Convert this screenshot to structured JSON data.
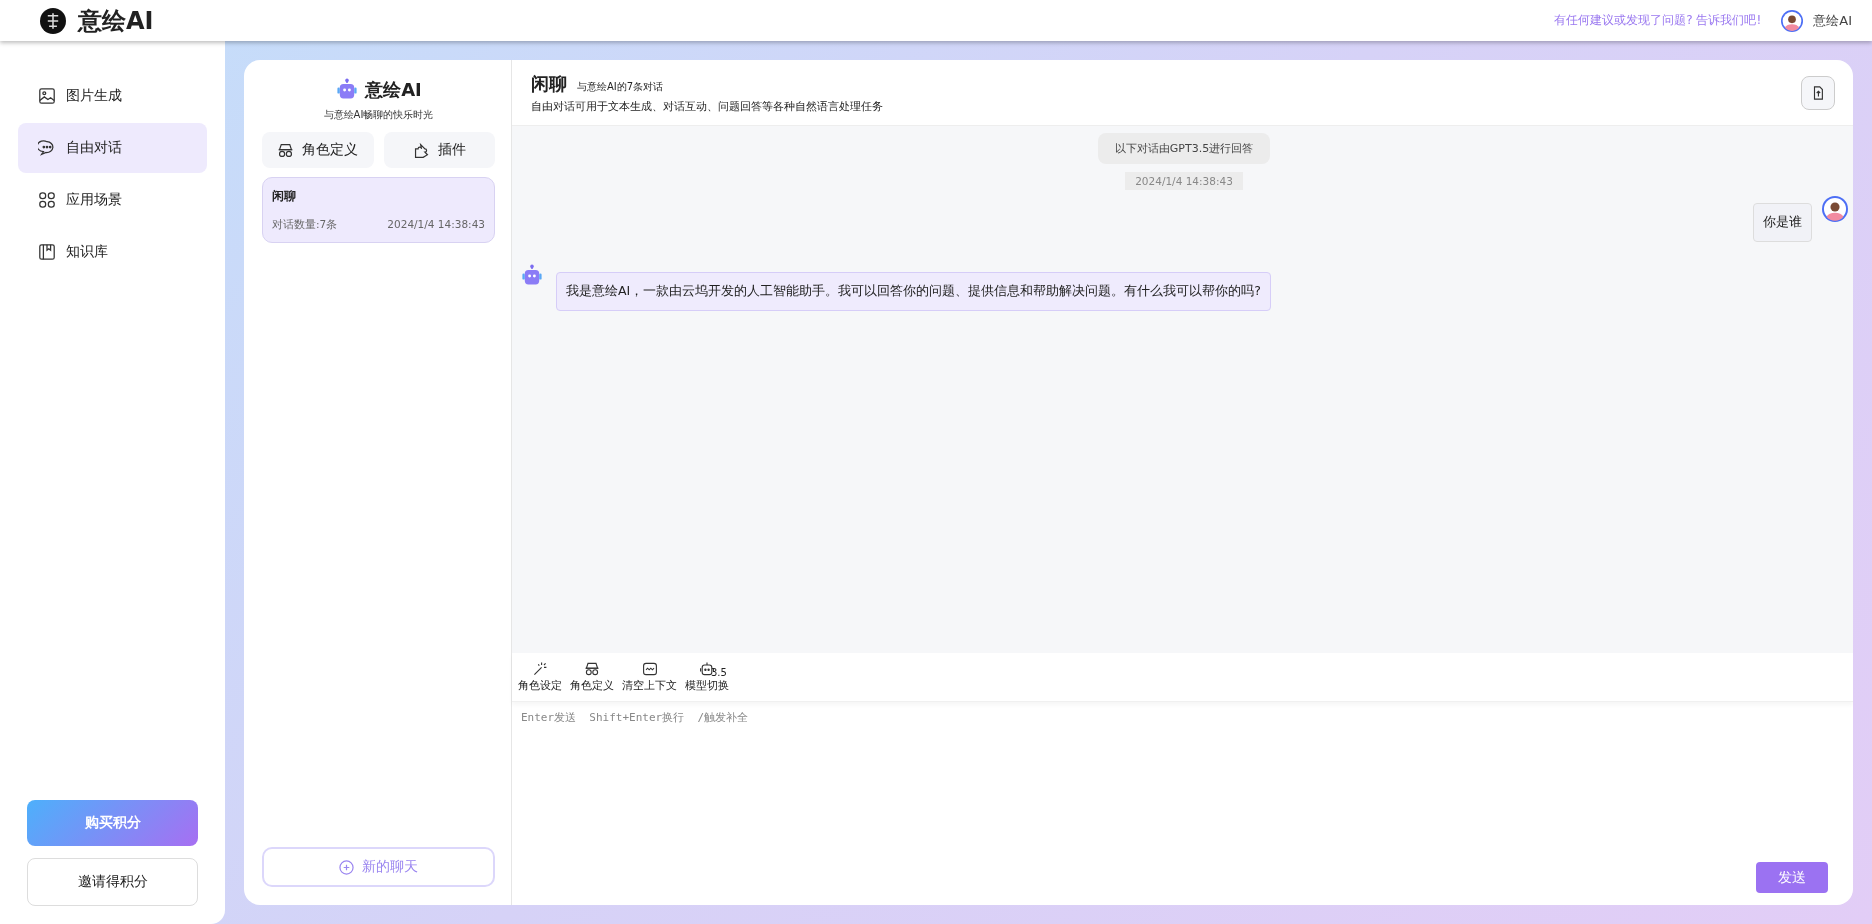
{
  "app": {
    "name": "意绘AI"
  },
  "header": {
    "feedback_link": "有任何建议或发现了问题? 告诉我们吧!",
    "user_name": "意绘AI"
  },
  "nav": [
    {
      "label": "图片生成",
      "kind": "image",
      "selected": false
    },
    {
      "label": "自由对话",
      "kind": "chat",
      "selected": true
    },
    {
      "label": "应用场景",
      "kind": "apps",
      "selected": false
    },
    {
      "label": "知识库",
      "kind": "book",
      "selected": false
    }
  ],
  "credits": {
    "buy": "购买积分",
    "invite": "邀请得积分"
  },
  "assistant": {
    "name": "意绘AI",
    "tagline": "与意绘AI畅聊的快乐时光",
    "buttons": [
      {
        "label": "角色定义",
        "kind": "mask"
      },
      {
        "label": "插件",
        "kind": "plugin"
      }
    ]
  },
  "sessions": [
    {
      "title": "闲聊",
      "count": "对话数量:7条",
      "time": "2024/1/4 14:38:43",
      "selected": true
    }
  ],
  "new_chat": "新的聊天",
  "chat": {
    "title": "闲聊",
    "subtitle": "与意绘AI的7条对话",
    "description": "自由对话可用于文本生成、对话互动、问题回答等各种自然语言处理任务",
    "notice": "以下对话由GPT3.5进行回答",
    "timestamp": "2024/1/4 14:38:43",
    "messages": [
      {
        "kind": "user",
        "text": "你是谁"
      },
      {
        "kind": "assistant",
        "text": "我是意绘AI，一款由云坞开发的人工智能助手。我可以回答你的问题、提供信息和帮助解决问题。有什么我可以帮你的吗?"
      }
    ]
  },
  "tools": [
    {
      "label": "角色设定",
      "kind": "wand"
    },
    {
      "label": "角色定义",
      "kind": "mask"
    },
    {
      "label": "清空上下文",
      "kind": "clear"
    },
    {
      "label": "模型切换",
      "kind": "robot",
      "badge": "3.5"
    }
  ],
  "input": {
    "placeholder": "Enter发送  Shift+Enter换行  /触发补全"
  },
  "send": "发送"
}
